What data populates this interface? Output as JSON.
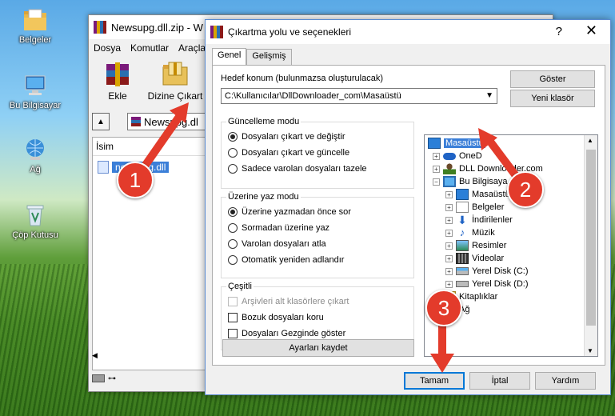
{
  "desktop": {
    "icons": [
      {
        "label": "Belgeler"
      },
      {
        "label": "Bu Bilgisayar"
      },
      {
        "label": "Ağ"
      },
      {
        "label": "Çöp Kutusu"
      }
    ]
  },
  "winrar": {
    "title": "Newsupg.dll.zip - W",
    "menu": [
      "Dosya",
      "Komutlar",
      "Araçla"
    ],
    "toolbar": {
      "add_label": "Ekle",
      "extract_label": "Dizine Çıkart"
    },
    "address": "Newsupg.dl",
    "list_header": "İsim",
    "file_name": "newsupg.dll"
  },
  "dialog": {
    "title": "Çıkartma yolu ve seçenekleri",
    "tabs": [
      "Genel",
      "Gelişmiş"
    ],
    "dest_label": "Hedef konum (bulunmazsa oluşturulacak)",
    "dest_value": "C:\\Kullanıcılar\\DllDownloader_com\\Masaüstü",
    "show_button": "Göster",
    "new_folder_button": "Yeni klasör",
    "update_mode": {
      "title": "Güncelleme modu",
      "options": [
        "Dosyaları çıkart ve değiştir",
        "Dosyaları çıkart ve güncelle",
        "Sadece varolan dosyaları tazele"
      ],
      "selected": 0
    },
    "overwrite_mode": {
      "title": "Üzerine yaz modu",
      "options": [
        "Üzerine yazmadan önce sor",
        "Sormadan üzerine yaz",
        "Varolan dosyaları atla",
        "Otomatik yeniden adlandır"
      ],
      "selected": 0
    },
    "misc": {
      "title": "Çeşitli",
      "options": [
        "Arşivleri alt klasörlere çıkart",
        "Bozuk dosyaları koru",
        "Dosyaları Gezginde göster"
      ]
    },
    "save_settings_button": "Ayarları kaydet",
    "tree": [
      {
        "label": "Masaüstü",
        "icon": "desktop-icon"
      },
      {
        "label": "OneD",
        "icon": "cloud-icon"
      },
      {
        "label": "DLL Downloader.com",
        "icon": "user-icon"
      },
      {
        "label": "Bu Bilgisaya",
        "icon": "computer-icon"
      },
      {
        "label": "Masaüstü",
        "icon": "desktop-icon"
      },
      {
        "label": "Belgeler",
        "icon": "documents-icon"
      },
      {
        "label": "İndirilenler",
        "icon": "download-icon"
      },
      {
        "label": "Müzik",
        "icon": "music-icon"
      },
      {
        "label": "Resimler",
        "icon": "pictures-icon"
      },
      {
        "label": "Videolar",
        "icon": "videos-icon"
      },
      {
        "label": "Yerel Disk (C:)",
        "icon": "drive-icon"
      },
      {
        "label": "Yerel Disk (D:)",
        "icon": "drive-icon"
      },
      {
        "label": "Kitaplıklar",
        "icon": "libraries-icon"
      },
      {
        "label": "Ağ",
        "icon": "network-icon"
      }
    ],
    "ok_button": "Tamam",
    "cancel_button": "İptal",
    "help_button": "Yardım"
  },
  "annotations": {
    "markers": [
      "1",
      "2",
      "3"
    ],
    "color": "#e33b2b"
  }
}
